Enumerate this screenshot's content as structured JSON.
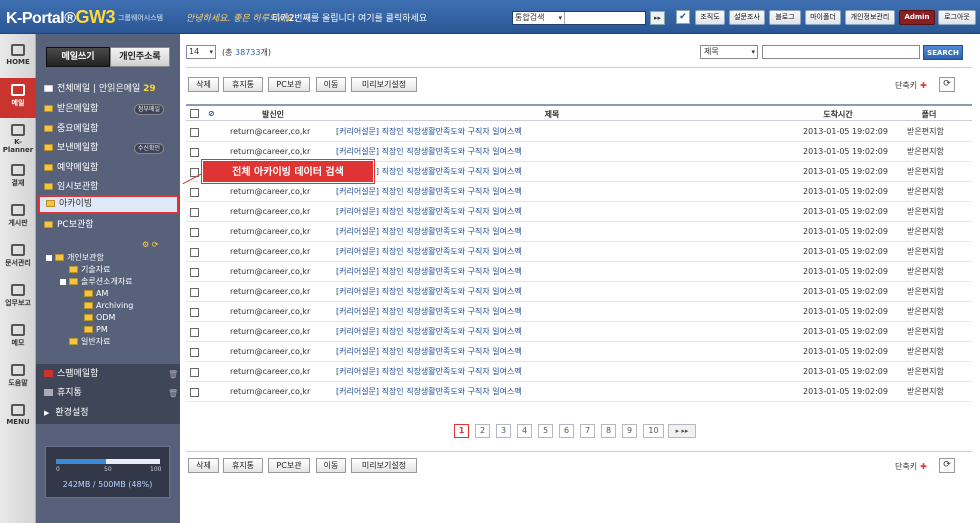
{
  "app": {
    "logo": "K-Portal",
    "logo_mark": "®",
    "logo_gw": "GW3",
    "logo_sub": "그룹웨어시스템",
    "slogan": "안녕하세요. 좋은 하루되세요.",
    "notice": "티커2번째를 올립니다 여기를 클릭하세요",
    "search_scope": "통합검색",
    "search_go": "▸▸"
  },
  "top_buttons": [
    {
      "label": "조직도"
    },
    {
      "label": "설문조사"
    },
    {
      "label": "블로그"
    },
    {
      "label": "마이폴더"
    },
    {
      "label": "개인정보관리"
    },
    {
      "label": "Admin"
    },
    {
      "label": "로그아웃"
    }
  ],
  "nav": [
    {
      "label": "HOME",
      "icon": "home-icon"
    },
    {
      "label": "메일",
      "icon": "mail-icon"
    },
    {
      "label": "K-Planner",
      "icon": "calendar-icon"
    },
    {
      "label": "결재",
      "icon": "approval-icon"
    },
    {
      "label": "게시판",
      "icon": "board-icon"
    },
    {
      "label": "문서관리",
      "icon": "document-icon"
    },
    {
      "label": "업무보고",
      "icon": "report-icon"
    },
    {
      "label": "메모",
      "icon": "memo-icon"
    },
    {
      "label": "도움말",
      "icon": "help-icon"
    },
    {
      "label": "MENU",
      "icon": "menu-icon"
    }
  ],
  "sidebar": {
    "compose": "메일쓰기",
    "address_book": "개인주소록",
    "all_mail": "전체메일",
    "unread_label": "안읽은메일",
    "unread_count": "29",
    "inbox": "받은메일함",
    "attach_badge": "첨부메일",
    "important": "중요메일함",
    "sent": "보낸메일함",
    "confirm_badge": "수신확인",
    "scheduled": "예약메일함",
    "drafts": "임시보관함",
    "archive": "아카이빙",
    "pc_store": "PC보관함",
    "tree": {
      "root": "개인보관함",
      "tech": "기술자료",
      "solutions": "솔루션소개자료",
      "am": "AM",
      "archiving": "Archiving",
      "odm": "ODM",
      "pm": "PM",
      "general": "일반자료"
    },
    "spam": "스팸메일함",
    "trash": "휴지통",
    "settings": "환경설정",
    "quota": {
      "ticks": [
        "0",
        "50",
        "100"
      ],
      "used_pct": 48,
      "text": "242MB / 500MB  (48%)"
    }
  },
  "callout": "전체 아카이빙 데이터 검색",
  "list": {
    "per_page": "14",
    "total_prefix": "(총",
    "total_count": "38733",
    "total_suffix": "개)",
    "search_field": "제목",
    "search_btn": "SEARCH",
    "actions": [
      "삭제",
      "휴지통",
      "PC보관",
      "이동",
      "미리보기설정"
    ],
    "shortcut": "단축키",
    "columns": {
      "sender": "발신인",
      "subject": "제목",
      "date": "도착시간",
      "folder": "폴더"
    },
    "rows": [
      {
        "sender": "return@career,co,kr",
        "subject": "[커리어설문] 직장인 직장생활만족도와 구직자 일여스펙",
        "date": "2013-01-05 19:02:09",
        "folder": "받은편지함"
      },
      {
        "sender": "return@career,co,kr",
        "subject": "[커리어설문] 직장인 직장생활만족도와 구직자 일여스펙",
        "date": "2013-01-05 19:02:09",
        "folder": "받은편지함"
      },
      {
        "sender": "return@career,co,kr",
        "subject": "[커리어설문] 직장인 직장생활만족도와 구직자 일여스펙",
        "date": "2013-01-05 19:02:09",
        "folder": "받은편지함"
      },
      {
        "sender": "return@career,co,kr",
        "subject": "[커리어설문] 직장인 직장생활만족도와 구직자 일여스펙",
        "date": "2013-01-05 19:02:09",
        "folder": "받은편지함"
      },
      {
        "sender": "return@career,co,kr",
        "subject": "[커리어설문] 직장인 직장생활만족도와 구직자 일여스펙",
        "date": "2013-01-05 19:02:09",
        "folder": "받은편지함"
      },
      {
        "sender": "return@career,co,kr",
        "subject": "[커리어설문] 직장인 직장생활만족도와 구직자 일여스펙",
        "date": "2013-01-05 19:02:09",
        "folder": "받은편지함"
      },
      {
        "sender": "return@career,co,kr",
        "subject": "[커리어설문] 직장인 직장생활만족도와 구직자 일여스펙",
        "date": "2013-01-05 19:02:09",
        "folder": "받은편지함"
      },
      {
        "sender": "return@career,co,kr",
        "subject": "[커리어설문] 직장인 직장생활만족도와 구직자 일여스펙",
        "date": "2013-01-05 19:02:09",
        "folder": "받은편지함"
      },
      {
        "sender": "return@career,co,kr",
        "subject": "[커리어설문] 직장인 직장생활만족도와 구직자 일여스펙",
        "date": "2013-01-05 19:02:09",
        "folder": "받은편지함"
      },
      {
        "sender": "return@career,co,kr",
        "subject": "[커리어설문] 직장인 직장생활만족도와 구직자 일여스펙",
        "date": "2013-01-05 19:02:09",
        "folder": "받은편지함"
      },
      {
        "sender": "return@career,co,kr",
        "subject": "[커리어설문] 직장인 직장생활만족도와 구직자 일여스펙",
        "date": "2013-01-05 19:02:09",
        "folder": "받은편지함"
      },
      {
        "sender": "return@career,co,kr",
        "subject": "[커리어설문] 직장인 직장생활만족도와 구직자 일여스펙",
        "date": "2013-01-05 19:02:09",
        "folder": "받은편지함"
      },
      {
        "sender": "return@career,co,kr",
        "subject": "[커리어설문] 직장인 직장생활만족도와 구직자 일여스펙",
        "date": "2013-01-05 19:02:09",
        "folder": "받은편지함"
      },
      {
        "sender": "return@career,co,kr",
        "subject": "[커리어설문] 직장인 직장생활만족도와 구직자 일여스펙",
        "date": "2013-01-05 19:02:09",
        "folder": "받은편지함"
      }
    ],
    "pages": [
      "1",
      "2",
      "3",
      "4",
      "5",
      "6",
      "7",
      "8",
      "9",
      "10"
    ],
    "current_page": "1",
    "next": "▸ ▸▸"
  },
  "colors": {
    "accent": "#e03434",
    "topbar": "#2a5694",
    "sidebar": "#57617a",
    "link": "#1f4e9e"
  }
}
